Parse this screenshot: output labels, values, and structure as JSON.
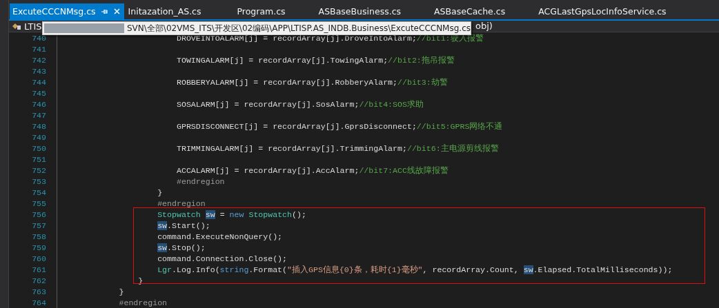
{
  "tabs": [
    {
      "label": "ExcuteCCCNMsg.cs",
      "selected": true
    },
    {
      "label": "Initazation_AS.cs",
      "selected": false
    },
    {
      "label": "Program.cs",
      "selected": false
    },
    {
      "label": "ASBaseBusiness.cs",
      "selected": false
    },
    {
      "label": "ASBaseCache.cs",
      "selected": false
    },
    {
      "label": "ACGLastGpsLocInfoService.cs",
      "selected": false
    }
  ],
  "navigation_bar": {
    "project": "LTIS",
    "member": "obj)"
  },
  "tooltip": {
    "path": "SVN\\全部\\02VMS_ITS\\开发区\\02编码\\APP\\LTISP.AS_INDB.Business\\ExcuteCCCNMsg.cs"
  },
  "editor": {
    "blocks": [
      {
        "kind": "plain",
        "lines": [
          {
            "number": "740",
            "tokens": [
              {
                "kind": "plain",
                "text": "                        DROVEINTOALARM[j] = recordArray[j].DroveIntoAlarm;"
              },
              {
                "kind": "comment",
                "text": "//bit1:驶入报警"
              }
            ]
          },
          {
            "number": "741"
          },
          {
            "number": "742",
            "tokens": [
              {
                "kind": "plain",
                "text": "                        TOWINGALARM[j] = recordArray[j].TowingAlarm;"
              },
              {
                "kind": "comment",
                "text": "//bit2:拖吊报警"
              }
            ]
          },
          {
            "number": "743"
          },
          {
            "number": "744",
            "tokens": [
              {
                "kind": "plain",
                "text": "                        ROBBERYALARM[j] = recordArray[j].RobberyAlarm;"
              },
              {
                "kind": "comment",
                "text": "//bit3:劫警"
              }
            ]
          },
          {
            "number": "745"
          },
          {
            "number": "746",
            "tokens": [
              {
                "kind": "plain",
                "text": "                        SOSALARM[j] = recordArray[j].SosAlarm;"
              },
              {
                "kind": "comment",
                "text": "//bit4:SOS求助"
              }
            ]
          },
          {
            "number": "747"
          },
          {
            "number": "748",
            "tokens": [
              {
                "kind": "plain",
                "text": "                        GPRSDISCONNECT[j] = recordArray[j].GprsDisconnect;"
              },
              {
                "kind": "comment",
                "text": "//bit5:GPRS网络不通"
              }
            ]
          },
          {
            "number": "749"
          },
          {
            "number": "750",
            "tokens": [
              {
                "kind": "plain",
                "text": "                        TRIMMINGALARM[j] = recordArray[j].TrimmingAlarm;"
              },
              {
                "kind": "comment",
                "text": "//bit6:主电源剪线报警"
              }
            ]
          },
          {
            "number": "751"
          },
          {
            "number": "752",
            "tokens": [
              {
                "kind": "plain",
                "text": "                        ACCALARM[j] = recordArray[j].AccAlarm;"
              },
              {
                "kind": "comment",
                "text": "//bit7:ACC线故障报警"
              }
            ]
          },
          {
            "number": "753",
            "tokens": [
              {
                "kind": "preproc",
                "text": "                        #endregion"
              }
            ]
          },
          {
            "number": "754",
            "tokens": [
              {
                "kind": "plain",
                "text": "                    }"
              }
            ]
          },
          {
            "number": "755",
            "tokens": [
              {
                "kind": "preproc",
                "text": "                    #endregion"
              }
            ]
          }
        ]
      },
      {
        "kind": "framed",
        "lines": [
          {
            "number": "756",
            "tokens": [
              {
                "kind": "type",
                "text": "                    Stopwatch "
              },
              {
                "kind": "highlight",
                "text": "sw"
              },
              {
                "kind": "plain",
                "text": " = "
              },
              {
                "kind": "keyword",
                "text": "new "
              },
              {
                "kind": "type",
                "text": "Stopwatch"
              },
              {
                "kind": "plain",
                "text": "();"
              }
            ]
          },
          {
            "number": "757",
            "tokens": [
              {
                "kind": "highlight",
                "text": "                    sw"
              },
              {
                "kind": "plain",
                "text": ".Start();"
              }
            ]
          },
          {
            "number": "758",
            "tokens": [
              {
                "kind": "plain",
                "text": "                    command.ExecuteNonQuery();"
              }
            ]
          },
          {
            "number": "759",
            "tokens": [
              {
                "kind": "highlight",
                "text": "                    sw"
              },
              {
                "kind": "plain",
                "text": ".Stop();"
              }
            ]
          },
          {
            "number": "760",
            "tokens": [
              {
                "kind": "plain",
                "text": "                    command.Connection.Close();"
              }
            ]
          },
          {
            "number": "761",
            "tokens": [
              {
                "kind": "type",
                "text": "                    Lgr"
              },
              {
                "kind": "plain",
                "text": ".Log.Info("
              },
              {
                "kind": "keyword",
                "text": "string"
              },
              {
                "kind": "plain",
                "text": ".Format("
              },
              {
                "kind": "string",
                "text": "\"插入GPS信息{0}条，耗时{1}毫秒\""
              },
              {
                "kind": "plain",
                "text": ", recordArray.Count, "
              },
              {
                "kind": "highlight",
                "text": "sw"
              },
              {
                "kind": "plain",
                "text": ".Elapsed.TotalMilliseconds));"
              }
            ]
          },
          {
            "number": "762",
            "tokens": [
              {
                "kind": "plain",
                "text": "                }"
              }
            ]
          }
        ]
      },
      {
        "kind": "plain",
        "lines": [
          {
            "number": "763",
            "tokens": [
              {
                "kind": "plain",
                "text": "            }"
              }
            ]
          },
          {
            "number": "764",
            "tokens": [
              {
                "kind": "preproc",
                "text": "            #endregion"
              }
            ]
          }
        ]
      }
    ]
  }
}
